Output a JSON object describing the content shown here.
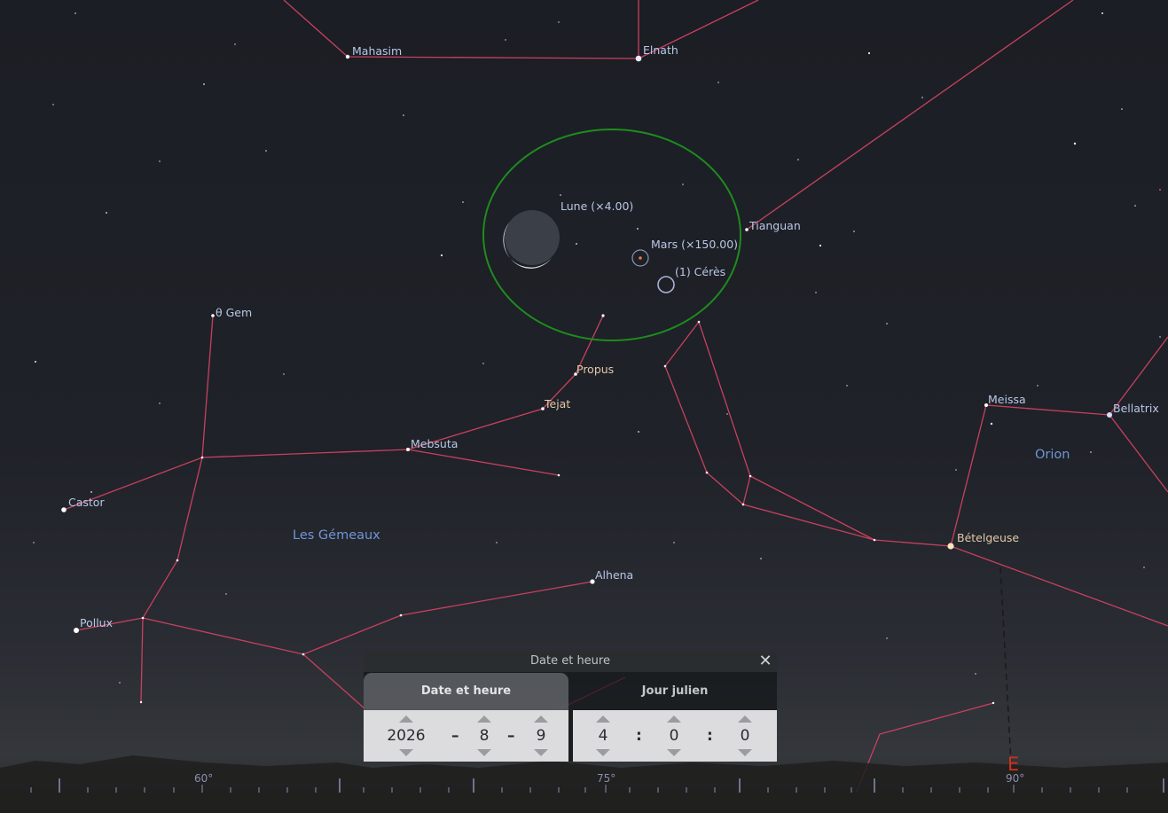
{
  "constellations": {
    "gemini": "Les Gémeaux",
    "orion": "Orion"
  },
  "stars": {
    "mahasim": "Mahasim",
    "elnath": "Elnath",
    "tianguan": "Tianguan",
    "theta_gem": "θ Gem",
    "propus": "Propus",
    "tejat": "Tejat",
    "mebsuta": "Mebsuta",
    "castor": "Castor",
    "pollux": "Pollux",
    "alhena": "Alhena",
    "meissa": "Meissa",
    "bellatrix": "Bellatrix",
    "betelgeuse": "Bételgeuse"
  },
  "objects": {
    "moon": "Lune (×4.00)",
    "mars": "Mars (×150.00)",
    "ceres": "(1) Cérès"
  },
  "horizon": {
    "az_60": "60°",
    "az_75": "75°",
    "az_90": "90°",
    "cardinal_east": "E"
  },
  "colors": {
    "constellation_lines": "#c8405e",
    "fov_circle": "#1e8c1e",
    "star_labels": "#b9c8e6",
    "constellation_names": "#6f95d8",
    "cardinal": "#d2301c"
  },
  "dialog": {
    "title": "Date et heure",
    "close_icon": "close-icon",
    "tabs": {
      "date_time": "Date et heure",
      "julian_day": "Jour julien"
    },
    "date": {
      "year": "2026",
      "month": "8",
      "day": "9",
      "sep": "–"
    },
    "time": {
      "hour": "4",
      "minute": "0",
      "second": "0",
      "sep": ":"
    }
  }
}
